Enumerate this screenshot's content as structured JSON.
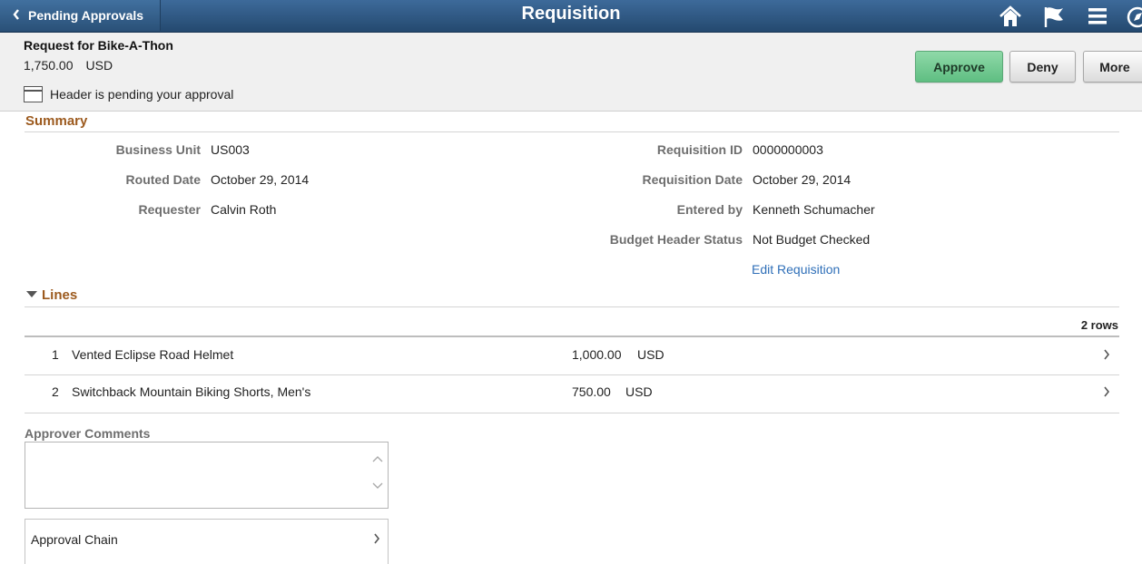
{
  "banner": {
    "back_label": "Pending Approvals",
    "title": "Requisition",
    "icons": [
      "home-icon",
      "flag-icon",
      "menu-icon",
      "navbar-icon"
    ]
  },
  "header": {
    "title": "Request for Bike-A-Thon",
    "amount": "1,750.00",
    "currency": "USD",
    "pending_text": "Header is pending your approval"
  },
  "actions": {
    "approve": "Approve",
    "deny": "Deny",
    "more": "More"
  },
  "summary": {
    "title": "Summary",
    "business_unit_label": "Business Unit",
    "business_unit": "US003",
    "routed_date_label": "Routed Date",
    "routed_date": "October 29, 2014",
    "requester_label": "Requester",
    "requester": "Calvin Roth",
    "requisition_id_label": "Requisition ID",
    "requisition_id": "0000000003",
    "requisition_date_label": "Requisition Date",
    "requisition_date": "October 29, 2014",
    "entered_by_label": "Entered by",
    "entered_by": "Kenneth Schumacher",
    "budget_status_label": "Budget Header Status",
    "budget_status": "Not Budget Checked",
    "edit_link": "Edit Requisition"
  },
  "lines": {
    "title": "Lines",
    "rows_count": "2 rows",
    "items": [
      {
        "num": "1",
        "description": "Vented Eclipse Road Helmet",
        "amount": "1,000.00",
        "currency": "USD"
      },
      {
        "num": "2",
        "description": "Switchback Mountain Biking Shorts, Men's",
        "amount": "750.00",
        "currency": "USD"
      }
    ]
  },
  "comments": {
    "label": "Approver Comments",
    "value": ""
  },
  "approval_chain": {
    "label": "Approval Chain"
  },
  "colors": {
    "banner": "#2f5a85",
    "approve_button": "#6cc58d",
    "section_title": "#9c5a1e",
    "link": "#2f6fb8"
  }
}
